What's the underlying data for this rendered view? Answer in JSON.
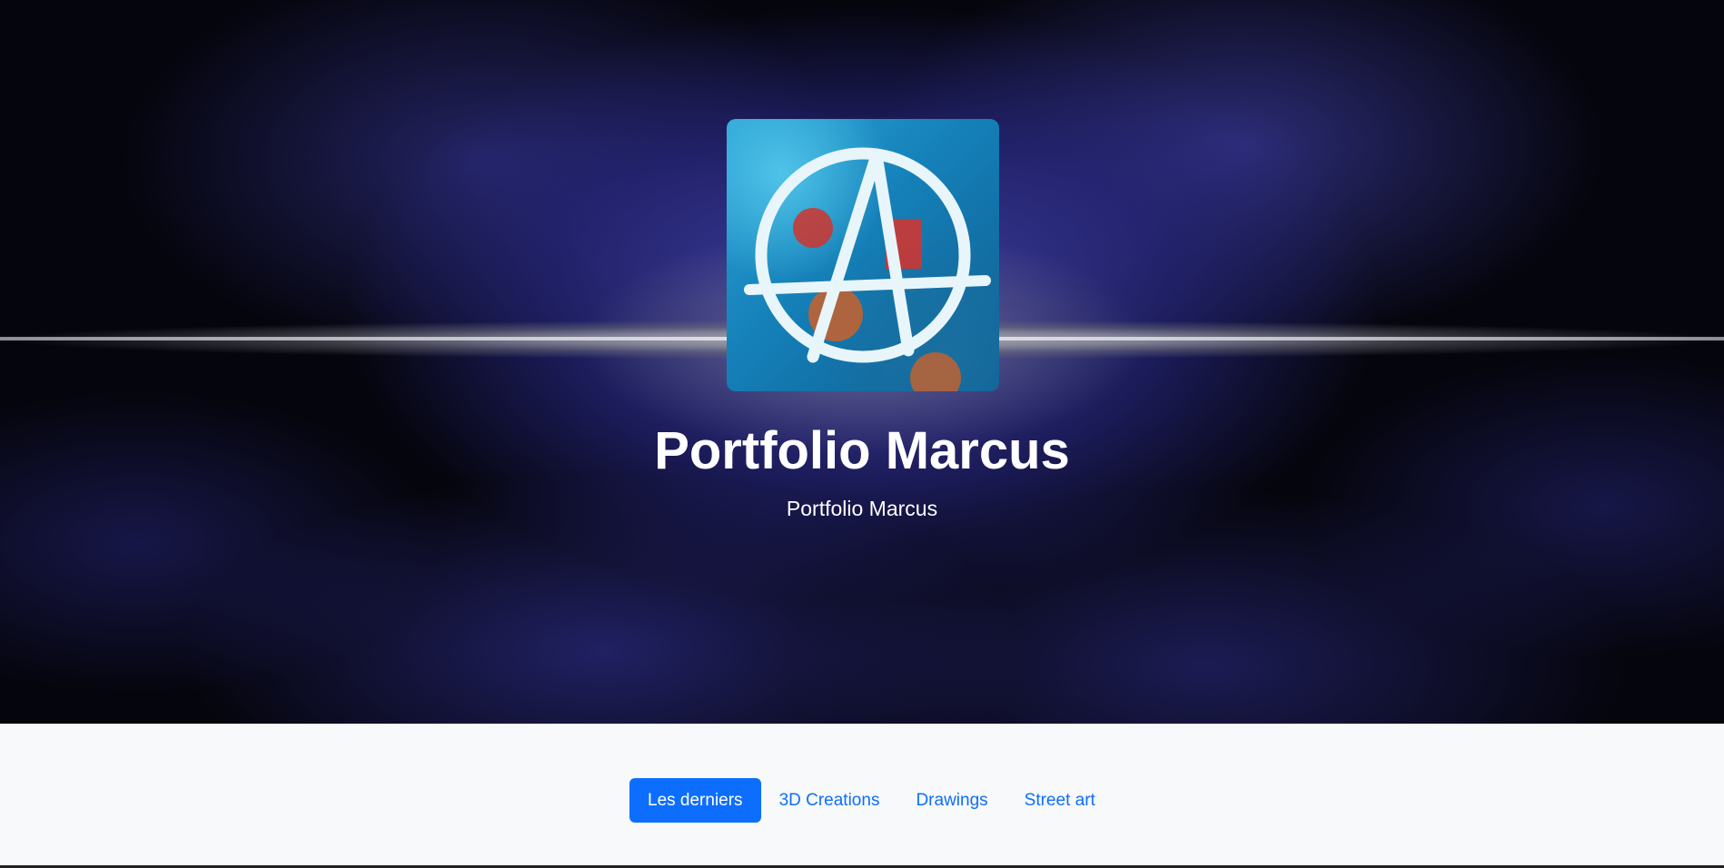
{
  "header": {
    "title": "Portfolio Marcus",
    "subtitle": "Portfolio Marcus"
  },
  "logo": {
    "icon": "anarchy-symbol-graffiti"
  },
  "nav": {
    "tabs": [
      {
        "label": "Les derniers",
        "active": true
      },
      {
        "label": "3D Creations",
        "active": false
      },
      {
        "label": "Drawings",
        "active": false
      },
      {
        "label": "Street art",
        "active": false
      }
    ]
  },
  "colors": {
    "accent": "#0d6efd",
    "hero_blue": "#2d2d96",
    "nav_background": "#f8f9fa"
  }
}
